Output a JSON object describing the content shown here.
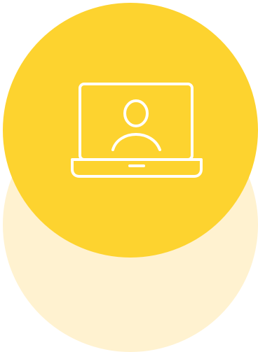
{
  "colors": {
    "front_circle": "#FDD32F",
    "back_circle": "#FFF2D0",
    "icon_stroke": "#FFFFFF"
  },
  "icons": {
    "main": "laptop-user-icon"
  }
}
